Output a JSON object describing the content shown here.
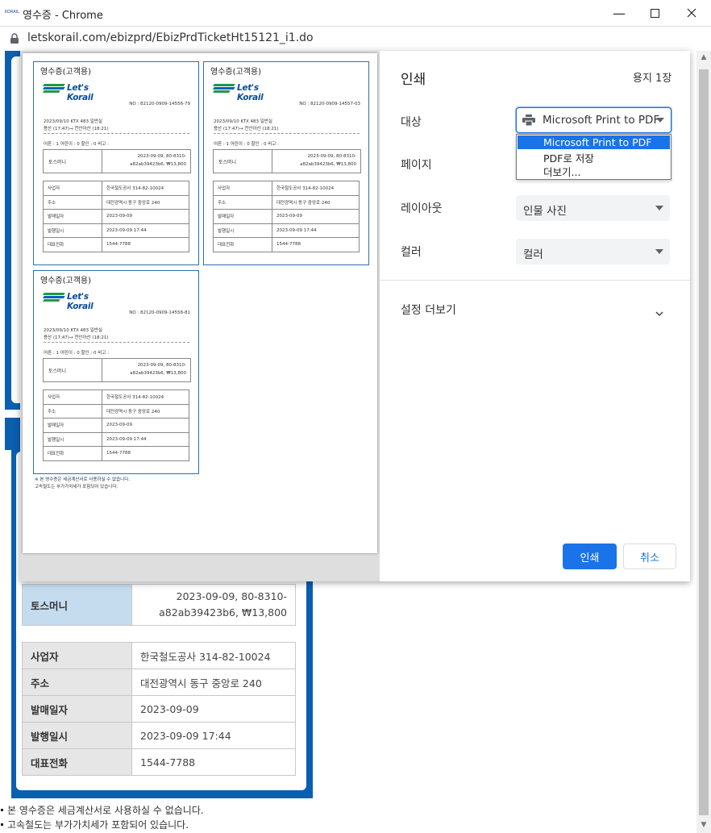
{
  "window": {
    "title": "영수증 - Chrome",
    "icon_text": "KORAIL"
  },
  "address": {
    "url": "letskorail.com/ebizprd/EbizPrdTicketHt15121_i1.do"
  },
  "background_page": {
    "payment": {
      "label": "토스머니",
      "value_line1": "2023-09-09, 80-8310-",
      "value_line2": "a82ab39423b6, ₩13,800"
    },
    "info_rows": [
      {
        "label": "사업자",
        "value": "한국철도공사 314-82-10024"
      },
      {
        "label": "주소",
        "value": "대전광역시 동구 중앙로 240"
      },
      {
        "label": "발매일자",
        "value": "2023-09-09"
      },
      {
        "label": "발행일시",
        "value": "2023-09-09 17:44"
      },
      {
        "label": "대표전화",
        "value": "1544-7788"
      }
    ],
    "notes": [
      "본 영수증은 세금계산서로 사용하실 수 없습니다.",
      "고속철도는 부가가치세가 포함되어 있습니다."
    ]
  },
  "preview": {
    "receipts": [
      {
        "title": "영수증(고객용)",
        "logo": "Let's Korail",
        "no": "NO : 82120-0909-14556-79",
        "line1": "2023/09/10 KTX 483 일반실",
        "line2": "용산 (17:47)→ 천안아산 (18:21)",
        "fare": "어른 : 1 어린이 : 0 할인 : 0 비고 :",
        "pay_label": "토스머니",
        "pay_v1": "2023-09-09, 80-8310-",
        "pay_v2": "a82ab39423b6, ₩13,800"
      },
      {
        "title": "영수증(고객용)",
        "logo": "Let's Korail",
        "no": "NO : 82120-0909-14557-03",
        "line1": "2023/09/10 KTX 483 일반실",
        "line2": "용산 (17:47)→ 천안아산 (18:21)",
        "fare": "어른 : 1 어린이 : 0 할인 : 0 비고 :",
        "pay_label": "토스머니",
        "pay_v1": "2023-09-09, 80-8310-",
        "pay_v2": "a82ab39423b6, ₩13,800"
      },
      {
        "title": "영수증(고객용)",
        "logo": "Let's Korail",
        "no": "NO : 82120-0909-14558-81",
        "line1": "2023/09/10 KTX 483 일반실",
        "line2": "용산 (17:47)→ 천안아산 (18:21)",
        "fare": "어른 : 1 어린이 : 0 할인 : 0 비고 :",
        "pay_label": "토스머니",
        "pay_v1": "2023-09-09, 80-8310-",
        "pay_v2": "a82ab39423b6, ₩13,800"
      }
    ],
    "info_rows": [
      {
        "label": "사업자",
        "value": "한국철도공사 314-82-10024"
      },
      {
        "label": "주소",
        "value": "대전광역시 동구 중앙로 240"
      },
      {
        "label": "발매일자",
        "value": "2023-09-09"
      },
      {
        "label": "발행일시",
        "value": "2023-09-09 17:44"
      },
      {
        "label": "대표전화",
        "value": "1544-7788"
      }
    ],
    "footnote_1": "본 영수증은 세금계산서로 사용하실 수 없습니다.",
    "footnote_2": "고속철도는 부가가치세가 포함되어 있습니다."
  },
  "print_settings": {
    "title": "인쇄",
    "sheets": "용지 1장",
    "destination_label": "대상",
    "destination_value": "Microsoft Print to PDF",
    "destination_options": [
      "Microsoft Print to PDF",
      "PDF로 저장",
      "더보기..."
    ],
    "pages_label": "페이지",
    "layout_label": "레이아웃",
    "layout_value": "인물 사진",
    "color_label": "컬러",
    "color_value": "컬러",
    "more_settings": "설정 더보기",
    "print_button": "인쇄",
    "cancel_button": "취소"
  },
  "colors": {
    "accent": "#1a73e8",
    "korail_blue": "#0a5fb0"
  }
}
